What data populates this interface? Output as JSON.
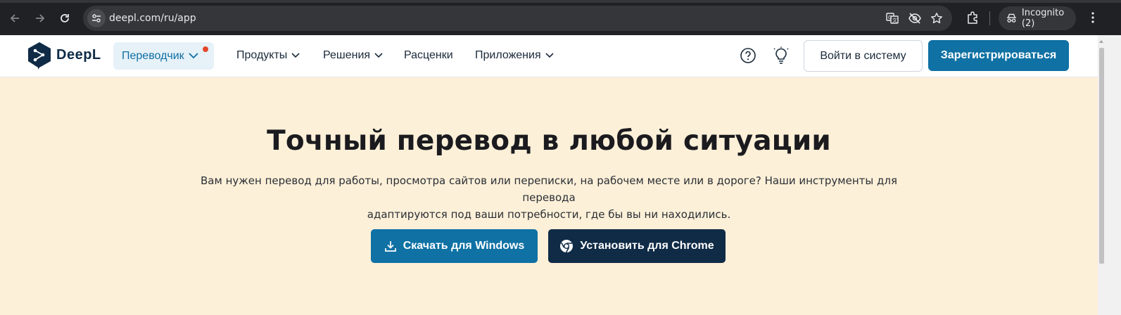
{
  "browser": {
    "url": "deepl.com/ru/app",
    "incognito_label": "Incognito (2)"
  },
  "header": {
    "logo_text": "DeepL",
    "translator_label": "Переводчик",
    "menu": [
      {
        "label": "Продукты",
        "has_dropdown": true
      },
      {
        "label": "Решения",
        "has_dropdown": true
      },
      {
        "label": "Расценки",
        "has_dropdown": false
      },
      {
        "label": "Приложения",
        "has_dropdown": true
      }
    ],
    "login_label": "Войти в систему",
    "signup_label": "Зарегистрироваться"
  },
  "hero": {
    "title": "Точный перевод в любой ситуации",
    "subtitle_line1": "Вам нужен перевод для работы, просмотра сайтов или переписки, на рабочем месте или в дороге? Наши инструменты для перевода",
    "subtitle_line2": "адаптируются под ваши потребности, где бы вы ни находились.",
    "download_label": "Скачать для Windows",
    "chrome_label": "Установить для Chrome"
  },
  "icons": {
    "back": "back-arrow-icon",
    "forward": "forward-arrow-icon",
    "reload": "reload-icon",
    "site_settings": "site-settings-icon",
    "translate": "translate-icon",
    "eye_off": "eye-off-icon",
    "star": "star-icon",
    "extensions": "extensions-icon",
    "menu": "kebab-menu-icon",
    "help": "help-icon",
    "bulb": "lightbulb-icon",
    "download": "download-icon",
    "chrome": "chrome-icon"
  },
  "colors": {
    "brand_blue": "#0f71a4",
    "brand_navy": "#0f2b46",
    "hero_bg": "#fdf0d8",
    "notification_dot": "#e3482b"
  }
}
